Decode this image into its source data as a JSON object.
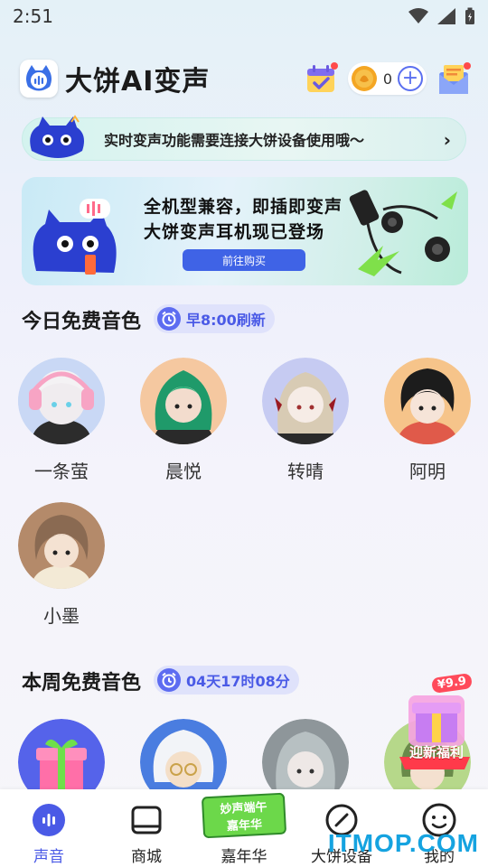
{
  "status_bar": {
    "time": "2:51"
  },
  "header": {
    "title": "大饼AI变声",
    "coin_count": "0"
  },
  "notice": {
    "text": "实时变声功能需要连接大饼设备使用哦～"
  },
  "banner": {
    "line1": "全机型兼容，即插即变声",
    "line2": "大饼变声耳机现已登场",
    "button": "前往购买"
  },
  "today": {
    "title": "今日免费音色",
    "refresh": "早8:00刷新",
    "voices": [
      {
        "name": "一条萤"
      },
      {
        "name": "晨悦"
      },
      {
        "name": "转晴"
      },
      {
        "name": "阿明"
      },
      {
        "name": "小墨"
      }
    ]
  },
  "weekly": {
    "title": "本周免费音色",
    "refresh": "04天17时08分"
  },
  "promo": {
    "price": "¥9.9",
    "label": "迎新福利"
  },
  "nav": {
    "items": [
      {
        "label": "声音"
      },
      {
        "label": "商城"
      },
      {
        "label": "嘉年华",
        "badge_line1": "妙声端午",
        "badge_line2": "嘉年华"
      },
      {
        "label": "大饼设备"
      },
      {
        "label": "我的"
      }
    ]
  },
  "watermark": "ITMOP.COM",
  "colors": {
    "accent": "#4a5ae6",
    "button": "#3f63e6"
  }
}
